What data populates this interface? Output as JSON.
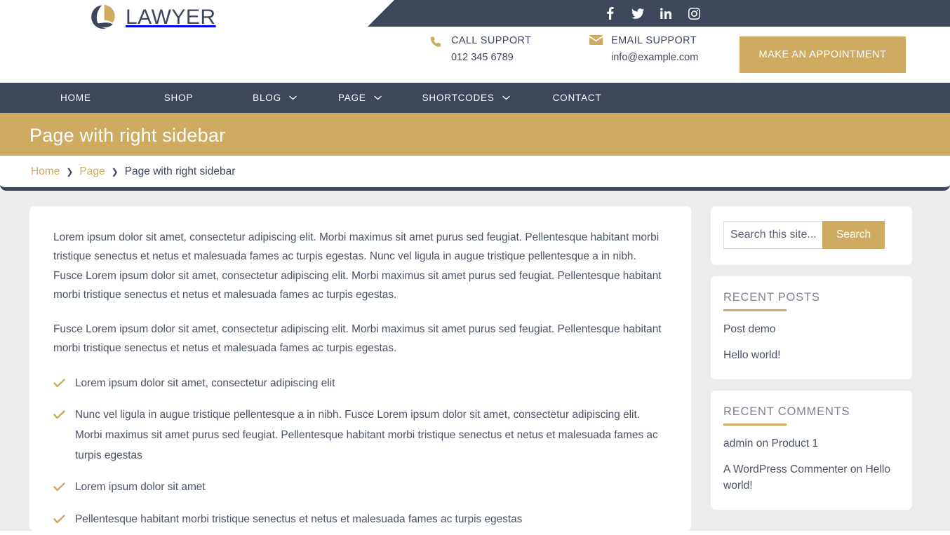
{
  "colors": {
    "navy": "#3e465c",
    "gold": "#cfab61",
    "body_bg": "#ececec",
    "text": "#4a5265"
  },
  "header": {
    "logo_text": "LAWYER",
    "logo_icon": "sailboat-circle-logo",
    "social": [
      {
        "name": "facebook-icon",
        "label": "Facebook"
      },
      {
        "name": "twitter-icon",
        "label": "Twitter"
      },
      {
        "name": "linkedin-icon",
        "label": "LinkedIn"
      },
      {
        "name": "instagram-icon",
        "label": "Instagram"
      }
    ],
    "contacts": [
      {
        "icon": "phone-icon",
        "label": "CALL SUPPORT",
        "value": "012 345 6789"
      },
      {
        "icon": "envelope-icon",
        "label": "EMAIL SUPPORT",
        "value": "info@example.com"
      }
    ],
    "appointment_button": "MAKE AN APPOINTMENT"
  },
  "nav": {
    "items": [
      {
        "label": "HOME",
        "has_dropdown": false
      },
      {
        "label": "SHOP",
        "has_dropdown": false
      },
      {
        "label": "BLOG",
        "has_dropdown": true
      },
      {
        "label": "PAGE",
        "has_dropdown": true
      },
      {
        "label": "SHORTCODES",
        "has_dropdown": true
      },
      {
        "label": "CONTACT",
        "has_dropdown": false
      }
    ]
  },
  "page": {
    "title": "Page with right sidebar",
    "breadcrumb": {
      "items": [
        {
          "label": "Home",
          "current": false
        },
        {
          "label": "Page",
          "current": false
        },
        {
          "label": "Page with right sidebar",
          "current": true
        }
      ],
      "separator": "›"
    }
  },
  "main": {
    "paragraphs": [
      "Lorem ipsum dolor sit amet, consectetur adipiscing elit. Morbi maximus sit amet purus sed feugiat. Pellentesque habitant morbi tristique senectus et netus et malesuada fames ac turpis egestas. Nunc vel ligula in augue tristique pellentesque a in nibh. Fusce Lorem ipsum dolor sit amet, consectetur adipiscing elit. Morbi maximus sit amet purus sed feugiat. Pellentesque habitant morbi tristique senectus et netus et malesuada fames ac turpis egestas.",
      "Fusce Lorem ipsum dolor sit amet, consectetur adipiscing elit. Morbi maximus sit amet purus sed feugiat. Pellentesque habitant morbi tristique senectus et netus et malesuada fames ac turpis egestas."
    ],
    "checklist": [
      "Lorem ipsum dolor sit amet, consectetur adipiscing elit",
      "Nunc vel ligula in augue tristique pellentesque a in nibh. Fusce Lorem ipsum dolor sit amet, consectetur adipiscing elit. Morbi maximus sit amet purus sed feugiat. Pellentesque habitant morbi tristique senectus et netus et malesuada fames ac turpis egestas",
      "Lorem ipsum dolor sit amet",
      "Pellentesque habitant morbi tristique senectus et netus et malesuada fames ac turpis egestas"
    ]
  },
  "sidebar": {
    "search": {
      "placeholder": "Search this site...",
      "value": "",
      "button_label": "Search"
    },
    "widgets": [
      {
        "title": "RECENT POSTS",
        "items": [
          "Post demo",
          "Hello world!"
        ]
      },
      {
        "title": "RECENT COMMENTS",
        "items": [
          "admin on Product 1",
          "A WordPress Commenter on Hello world!"
        ]
      }
    ]
  }
}
